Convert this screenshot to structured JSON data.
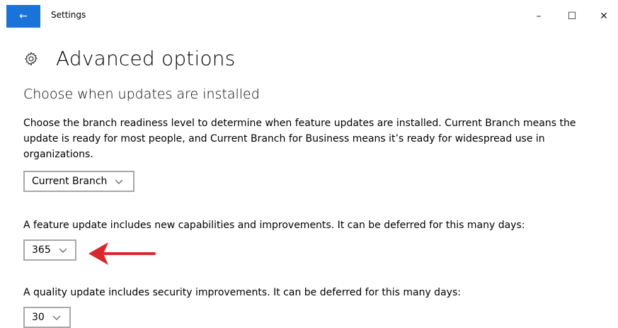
{
  "titlebar": {
    "app_title": "Settings",
    "back_icon": "←",
    "minimize_icon": "–",
    "maximize_icon": "☐",
    "close_icon": "✕"
  },
  "page": {
    "title": "Advanced options",
    "section_title": "Choose when updates are installed",
    "description": "Choose the branch readiness level to determine when feature updates are installed. Current Branch means the update is ready for most people, and Current Branch for Business means it’s ready for widespread use in organizations."
  },
  "branch_dropdown": {
    "value": "Current Branch"
  },
  "feature_update": {
    "label": "A feature update includes new capabilities and improvements. It can be deferred for this many days:",
    "value": "365"
  },
  "quality_update": {
    "label": "A quality update includes security improvements. It can be deferred for this many days:",
    "value": "30"
  },
  "colors": {
    "accent": "#1a73d9",
    "annotation_arrow": "#d8282b",
    "dropdown_border": "#a8a8a8"
  }
}
